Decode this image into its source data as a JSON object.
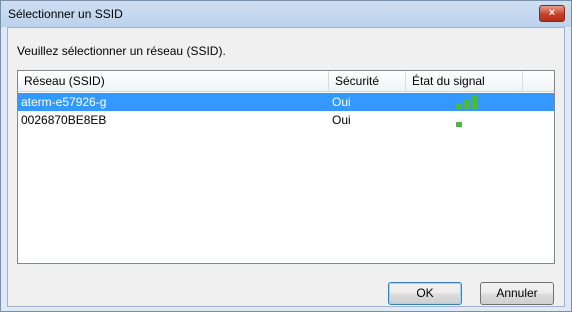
{
  "window": {
    "title": "Sélectionner un SSID",
    "close_glyph": "×"
  },
  "prompt": "Veuillez sélectionner un réseau (SSID).",
  "table": {
    "columns": [
      "Réseau (SSID)",
      "Sécurité",
      "État du signal"
    ],
    "rows": [
      {
        "ssid": "aterm-e57926-g",
        "security": "Oui",
        "signal_bars": 3,
        "selected": true
      },
      {
        "ssid": "0026870BE8EB",
        "security": "Oui",
        "signal_bars": 1,
        "selected": false
      }
    ],
    "signal_color": "#4ab845",
    "selection_color": "#3399ff"
  },
  "buttons": {
    "ok": "OK",
    "cancel": "Annuler"
  }
}
